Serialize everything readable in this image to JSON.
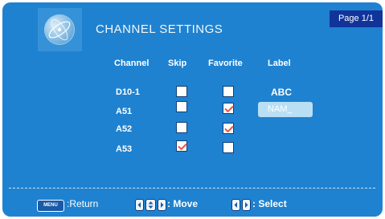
{
  "header": {
    "title": "CHANNEL SETTINGS",
    "page_indicator": "Page 1/1",
    "logo_icon": "globe-icon"
  },
  "table": {
    "columns": [
      "Channel",
      "Skip",
      "Favorite",
      "Label"
    ],
    "rows": [
      {
        "channel": "D10-1",
        "skip": false,
        "favorite": false,
        "label": "ABC",
        "editing": false
      },
      {
        "channel": "A51",
        "skip": false,
        "favorite": true,
        "label": "NAM_",
        "editing": true
      },
      {
        "channel": "A52",
        "skip": false,
        "favorite": true,
        "label": "",
        "editing": false
      },
      {
        "channel": "A53",
        "skip": true,
        "favorite": false,
        "label": "",
        "editing": false
      }
    ]
  },
  "footer": {
    "menu_key": "MENU",
    "return_label": ":Return",
    "move_label": ": Move",
    "select_label": ": Select"
  },
  "colors": {
    "background": "#1f82d0",
    "badge": "#11349b",
    "check": "#e8584b",
    "edit_field": "#b9dff5"
  }
}
